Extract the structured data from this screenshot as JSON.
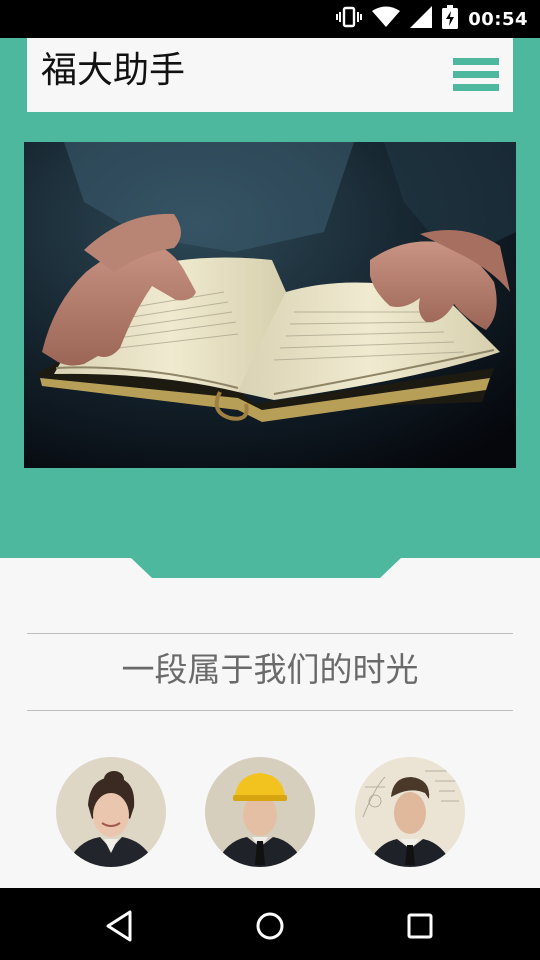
{
  "status_bar": {
    "time": "00:54",
    "icons": [
      "vibrate-icon",
      "wifi-icon",
      "cell-signal-icon",
      "battery-charging-icon"
    ]
  },
  "header": {
    "app_title": "福大助手",
    "menu_icon": "hamburger-menu-icon"
  },
  "hero": {
    "image": "hands-reading-open-book"
  },
  "section": {
    "heading": "一段属于我们的时光"
  },
  "members": [
    {
      "photo": "woman-smiling-portrait"
    },
    {
      "photo": "man-yellow-hardhat-portrait"
    },
    {
      "photo": "man-sketch-background-portrait"
    }
  ],
  "member_name_partial": "",
  "nav_bar": {
    "buttons": [
      "back-icon",
      "home-icon",
      "recents-icon"
    ]
  },
  "colors": {
    "accent": "#4db89e",
    "background": "#f7f7f7",
    "text": "#111111",
    "heading_text": "#6a6a6a"
  }
}
